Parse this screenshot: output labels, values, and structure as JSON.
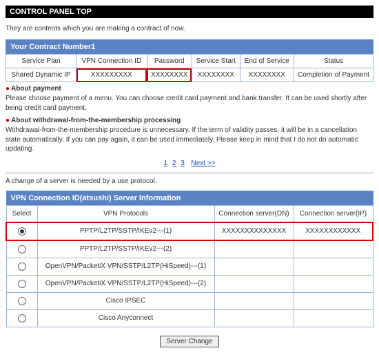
{
  "page_title": "CONTROL PANEL TOP",
  "intro": "They are contents which you are making a contract of now.",
  "contract": {
    "header": "Your Contract Number1",
    "columns": [
      "Service Plan",
      "VPN Connection ID",
      "Password",
      "Service Start",
      "End of Service",
      "Status"
    ],
    "row": {
      "plan": "Shared Dynamic IP",
      "vpn_id": "XXXXXXXXX",
      "password": "XXXXXXXX",
      "start": "XXXXXXXX",
      "end": "XXXXXXXX",
      "status": "Completion of Payment"
    }
  },
  "about_payment": {
    "title": "About payment",
    "body": "Please choose payment of a menu. You can choose credit card payment and bank transfer. It can be used shortly after being credit card payment."
  },
  "about_withdraw": {
    "title": "About withdrawal-from-the-membership processing",
    "body": "Withdrawal-from-the-membership procedure is unnecessary. If the term of validity passes, it will be in a cancellation state automatically. If you can pay again, it can be used immediately. Please keep in mind that I do not do automatic updating."
  },
  "pager": {
    "p1": "1",
    "p2": "2",
    "p3": "3",
    "next": "Next >>"
  },
  "server_note": "A change of a server is needed by a use protocol.",
  "server_info": {
    "header": "VPN Connection ID(atsushi) Server Information",
    "columns": [
      "Select",
      "VPN Protocols",
      "Connection server(DN)",
      "Connection server(IP)"
    ],
    "rows": [
      {
        "selected": true,
        "protocol": "PPTP/L2TP/SSTP/IKEv2---(1)",
        "dn": "XXXXXXXXXXXXXX",
        "ip": "XXXXXXXXXXXX"
      },
      {
        "selected": false,
        "protocol": "PPTP/L2TP/SSTP/IKEv2---(2)",
        "dn": "",
        "ip": ""
      },
      {
        "selected": false,
        "protocol": "OpenVPN/PacketiX VPN/SSTP/L2TP(HiSpeed)---(1)",
        "dn": "",
        "ip": ""
      },
      {
        "selected": false,
        "protocol": "OpenVPN/PacketiX VPN/SSTP/L2TP(HiSpeed)---(2)",
        "dn": "",
        "ip": ""
      },
      {
        "selected": false,
        "protocol": "Cisco IPSEC",
        "dn": "",
        "ip": ""
      },
      {
        "selected": false,
        "protocol": "Cisco Anyconnect",
        "dn": "",
        "ip": ""
      }
    ]
  },
  "button": "Server Change"
}
